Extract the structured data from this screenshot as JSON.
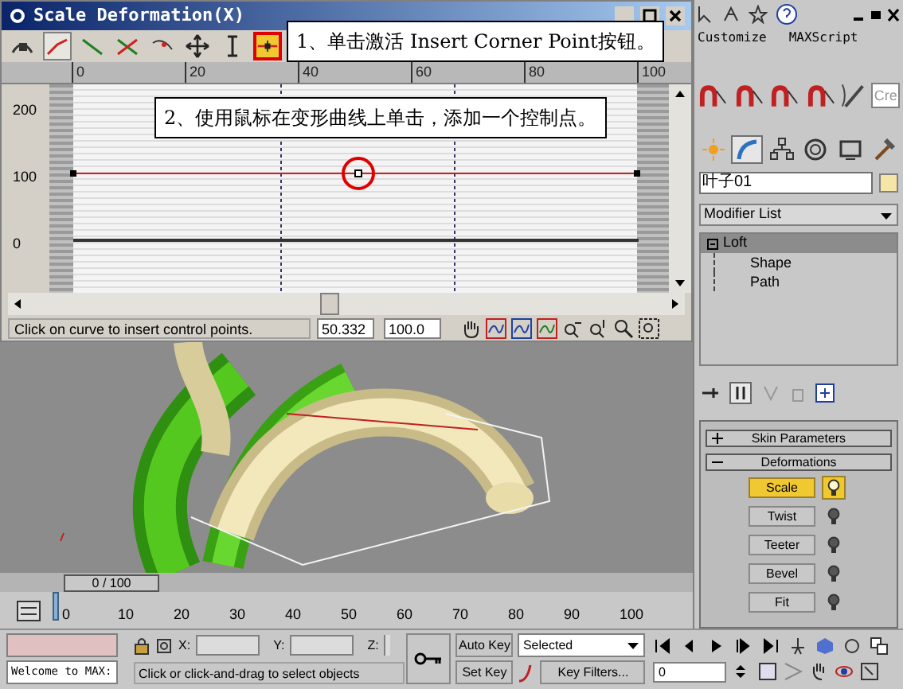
{
  "deform_window": {
    "title": "Scale Deformation(X)",
    "toolbar": [
      {
        "kind": "lock",
        "selected": false
      },
      {
        "kind": "curve-red",
        "selected": true
      },
      {
        "kind": "curve-green",
        "selected": false
      },
      {
        "kind": "curve-both",
        "selected": false
      },
      {
        "kind": "swap",
        "selected": false
      },
      {
        "kind": "move",
        "selected": false
      },
      {
        "kind": "scale",
        "selected": false
      },
      {
        "kind": "insert-corner",
        "selected": true
      }
    ],
    "ruler": [
      "0",
      "20",
      "40",
      "60",
      "80",
      "100"
    ],
    "y_labels": [
      "200",
      "100",
      "0"
    ],
    "status": "Click on curve to insert control points.",
    "x_value": "50.332",
    "y_value": "100.0"
  },
  "callouts": [
    "1、单击激活 Insert Corner Point按钮。",
    "2、使用鼠标在变形曲线上单击，添加一个控制点。"
  ],
  "menu": [
    "Customize",
    "MAXScript"
  ],
  "create_field": "Cre",
  "command_tabs": [
    {
      "kind": "create",
      "selected": false
    },
    {
      "kind": "modify",
      "selected": true
    },
    {
      "kind": "hierarchy",
      "selected": false
    },
    {
      "kind": "motion",
      "selected": false
    },
    {
      "kind": "display",
      "selected": false
    },
    {
      "kind": "utilities",
      "selected": false
    }
  ],
  "object_name": "叶子01",
  "modifier_list": "Modifier List",
  "stack": [
    {
      "label": "Loft",
      "selected": true,
      "children": [
        {
          "label": "Shape"
        },
        {
          "label": "Path"
        }
      ]
    }
  ],
  "rollouts": [
    {
      "label": "Skin Parameters",
      "expanded": false
    },
    {
      "label": "Deformations",
      "expanded": true
    }
  ],
  "deformations": [
    {
      "label": "Scale",
      "selected": true
    },
    {
      "label": "Twist",
      "selected": false
    },
    {
      "label": "Teeter",
      "selected": false
    },
    {
      "label": "Bevel",
      "selected": false
    },
    {
      "label": "Fit",
      "selected": false
    }
  ],
  "time_slider": "0 / 100",
  "track_ticks": [
    "0",
    "10",
    "20",
    "30",
    "40",
    "50",
    "60",
    "70",
    "80",
    "90",
    "100"
  ],
  "welcome": "Welcome to MAX:",
  "coords": [
    "X:",
    "Y:",
    "Z:"
  ],
  "auto_key": "Auto Key",
  "set_key": "Set Key",
  "key_mode": "Selected",
  "key_filters": "Key Filters...",
  "prompt": "Click or click-and-drag to select objects",
  "frame": "0"
}
